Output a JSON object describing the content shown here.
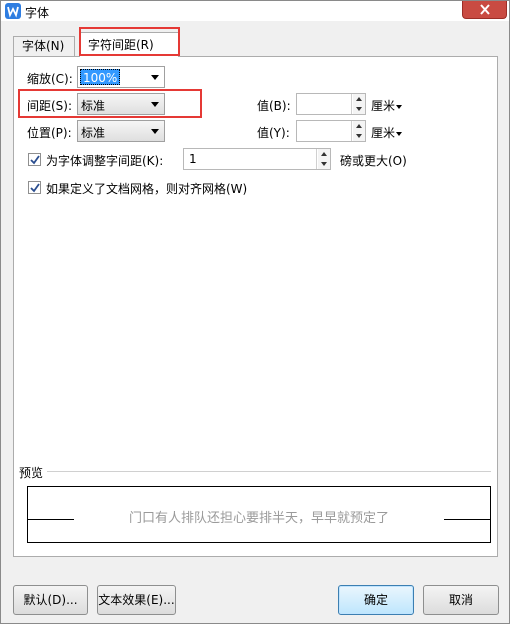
{
  "window": {
    "title": "字体",
    "accent": "#2e7de1",
    "close_color": "#c94b42"
  },
  "tabs": [
    {
      "label": "字体(N)",
      "active": false
    },
    {
      "label": "字符间距(R)",
      "active": true
    }
  ],
  "scale": {
    "label": "缩放(C):",
    "value": "100%"
  },
  "spacing": {
    "label": "间距(S):",
    "value": "标准",
    "value_label": "值(B):",
    "value_text": "",
    "unit": "厘米"
  },
  "position": {
    "label": "位置(P):",
    "value": "标准",
    "value_label": "值(Y):",
    "value_text": "",
    "unit": "厘米"
  },
  "kerning": {
    "label": "为字体调整字间距(K):",
    "checked": true,
    "value": "1",
    "suffix": "磅或更大(O)"
  },
  "grid": {
    "label": "如果定义了文档网格，则对齐网格(W)",
    "checked": true
  },
  "preview": {
    "label": "预览",
    "text": "门口有人排队还担心要排半天，早早就预定了"
  },
  "buttons": {
    "default": "默认(D)...",
    "text_effects": "文本效果(E)...",
    "ok": "确定",
    "cancel": "取消"
  },
  "highlight_color": "#e53935"
}
